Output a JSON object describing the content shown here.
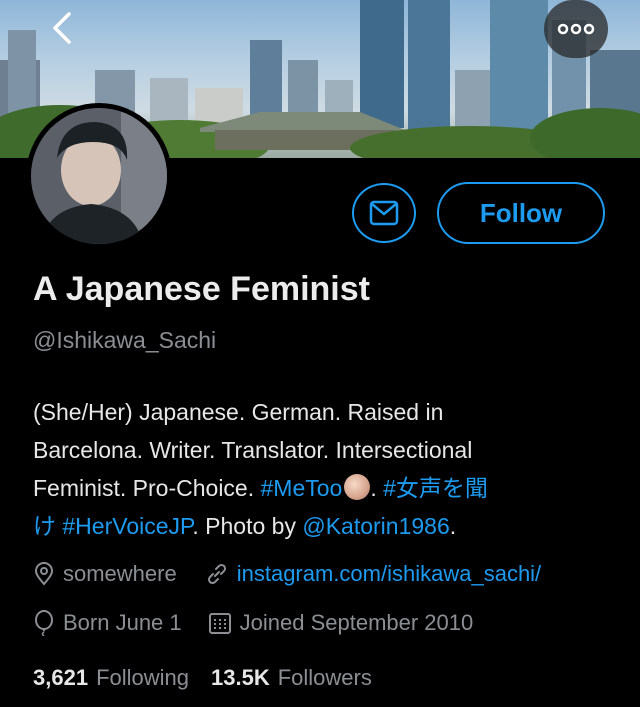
{
  "header": {
    "back_icon": "chevron-left-icon",
    "more_icon": "more-horizontal-icon"
  },
  "profile": {
    "name": "A Japanese Feminist",
    "handle": "@Ishikawa_Sachi",
    "follow_label": "Follow",
    "message_icon": "envelope-icon"
  },
  "bio": {
    "line1": "(She/Her) Japanese. German. Raised in",
    "line2": "Barcelona. Writer. Translator. Intersectional",
    "line3_text": "Feminist. Pro-Choice. ",
    "hashtag_metoo": "#MeToo",
    "line3_dot": ". ",
    "hashtag_jp_part1": "#女声を聞",
    "hashtag_jp_part2": "け",
    "hashtag_hervoicejp": "#HerVoiceJP",
    "photo_by": ". Photo by ",
    "mention": "@Katorin1986",
    "end_dot": "."
  },
  "meta": {
    "location": "somewhere",
    "website": "instagram.com/ishikawa_sachi/",
    "birthday": "Born June 1",
    "joined": "Joined September 2010"
  },
  "stats": {
    "following_count": "3,621",
    "following_label": "Following",
    "followers_count": "13.5K",
    "followers_label": "Followers"
  },
  "colors": {
    "accent": "#1d9bf0",
    "background": "#000000",
    "secondary_text": "#8b8f94"
  }
}
